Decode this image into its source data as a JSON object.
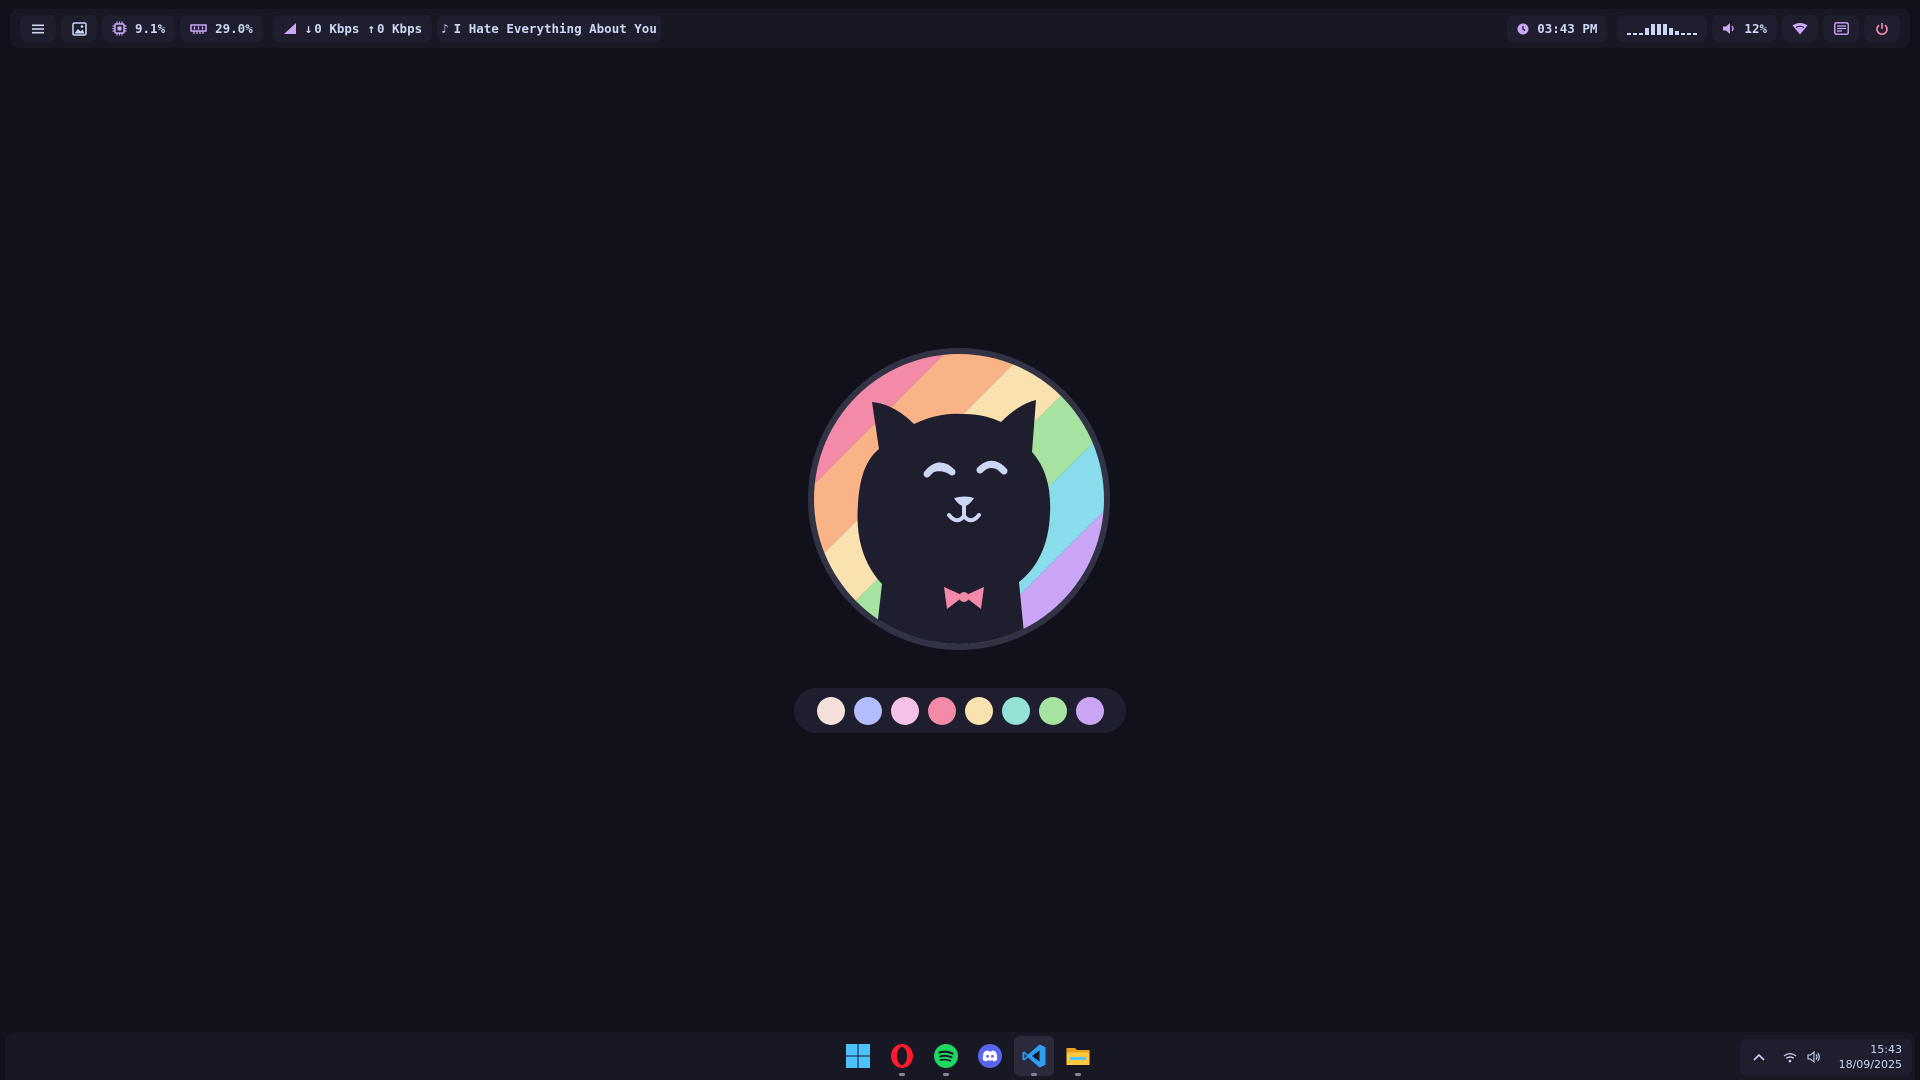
{
  "topbar": {
    "cpu": "9.1%",
    "memory": "29.0%",
    "net_down": "0 Kbps",
    "net_up": "0 Kbps",
    "media_note": "♪",
    "media_title": "I Hate Everything About You",
    "time": "03:43 PM",
    "volume": "12%",
    "cava_levels": [
      0.15,
      0.15,
      0.15,
      0.6,
      0.9,
      0.9,
      0.9,
      0.6,
      0.3,
      0.15,
      0.15,
      0.15
    ]
  },
  "palette": {
    "colors": [
      "#f5e0dc",
      "#b4befe",
      "#f5c2e7",
      "#f38ba8",
      "#f9e2af",
      "#94e2d5",
      "#a6e3a1",
      "#cba6f7"
    ]
  },
  "taskbar": {
    "apps": [
      {
        "name": "start-icon",
        "running": false,
        "active": false
      },
      {
        "name": "opera-icon",
        "running": true,
        "active": false
      },
      {
        "name": "spotify-icon",
        "running": true,
        "active": false
      },
      {
        "name": "discord-icon",
        "running": false,
        "active": false
      },
      {
        "name": "vscode-icon",
        "running": true,
        "active": true
      },
      {
        "name": "file-explorer-icon",
        "running": true,
        "active": false
      }
    ],
    "clock_time": "15:43",
    "clock_date": "18/09/2025"
  }
}
